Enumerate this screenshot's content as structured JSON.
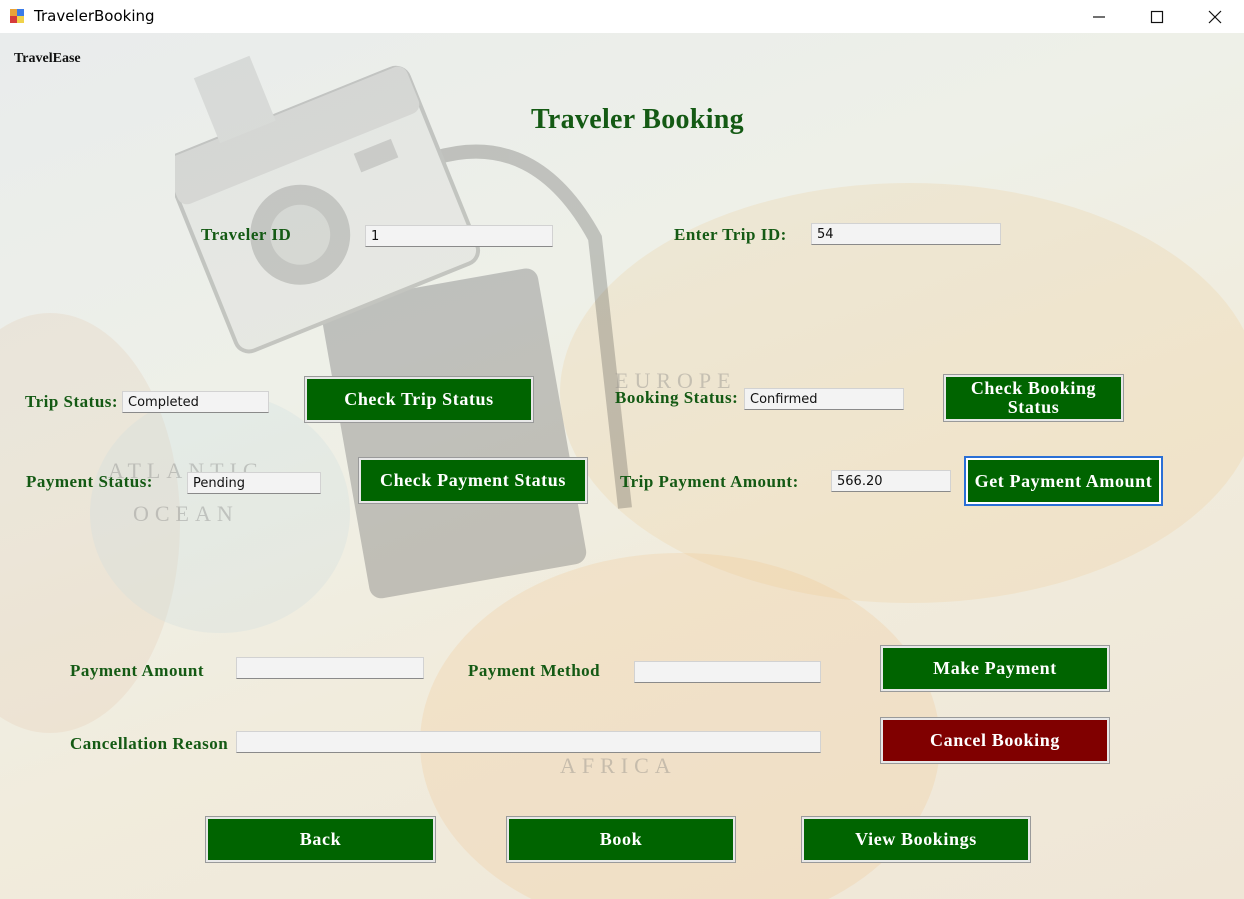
{
  "window": {
    "title": "TravelerBooking",
    "icon": "app-icon",
    "controls": [
      "minimize-icon",
      "maximize-icon",
      "close-icon"
    ]
  },
  "brand": "TravelEase",
  "heading": "Traveler Booking",
  "fields": {
    "traveler_id": {
      "label": "Traveler ID",
      "value": "1"
    },
    "trip_id": {
      "label": "Enter Trip ID:",
      "value": "54"
    },
    "trip_status": {
      "label": "Trip Status:",
      "value": "Completed"
    },
    "booking_status": {
      "label": "Booking Status:",
      "value": "Confirmed"
    },
    "payment_status": {
      "label": "Payment Status:",
      "value": "Pending"
    },
    "trip_payment_amount": {
      "label": "Trip Payment Amount:",
      "value": "566.20"
    },
    "payment_amount": {
      "label": "Payment Amount",
      "value": ""
    },
    "payment_method": {
      "label": "Payment Method",
      "value": ""
    },
    "cancellation_reason": {
      "label": "Cancellation Reason",
      "value": ""
    }
  },
  "buttons": {
    "check_trip_status": "Check Trip Status",
    "check_booking_status": "Check Booking Status",
    "check_payment_status": "Check Payment Status",
    "get_payment_amount": "Get Payment Amount",
    "make_payment": "Make Payment",
    "cancel_booking": "Cancel Booking",
    "back": "Back",
    "book": "Book",
    "view_bookings": "View Bookings"
  },
  "colors": {
    "button_green": "#006400",
    "button_red": "#800000",
    "label_green": "#145a14"
  }
}
